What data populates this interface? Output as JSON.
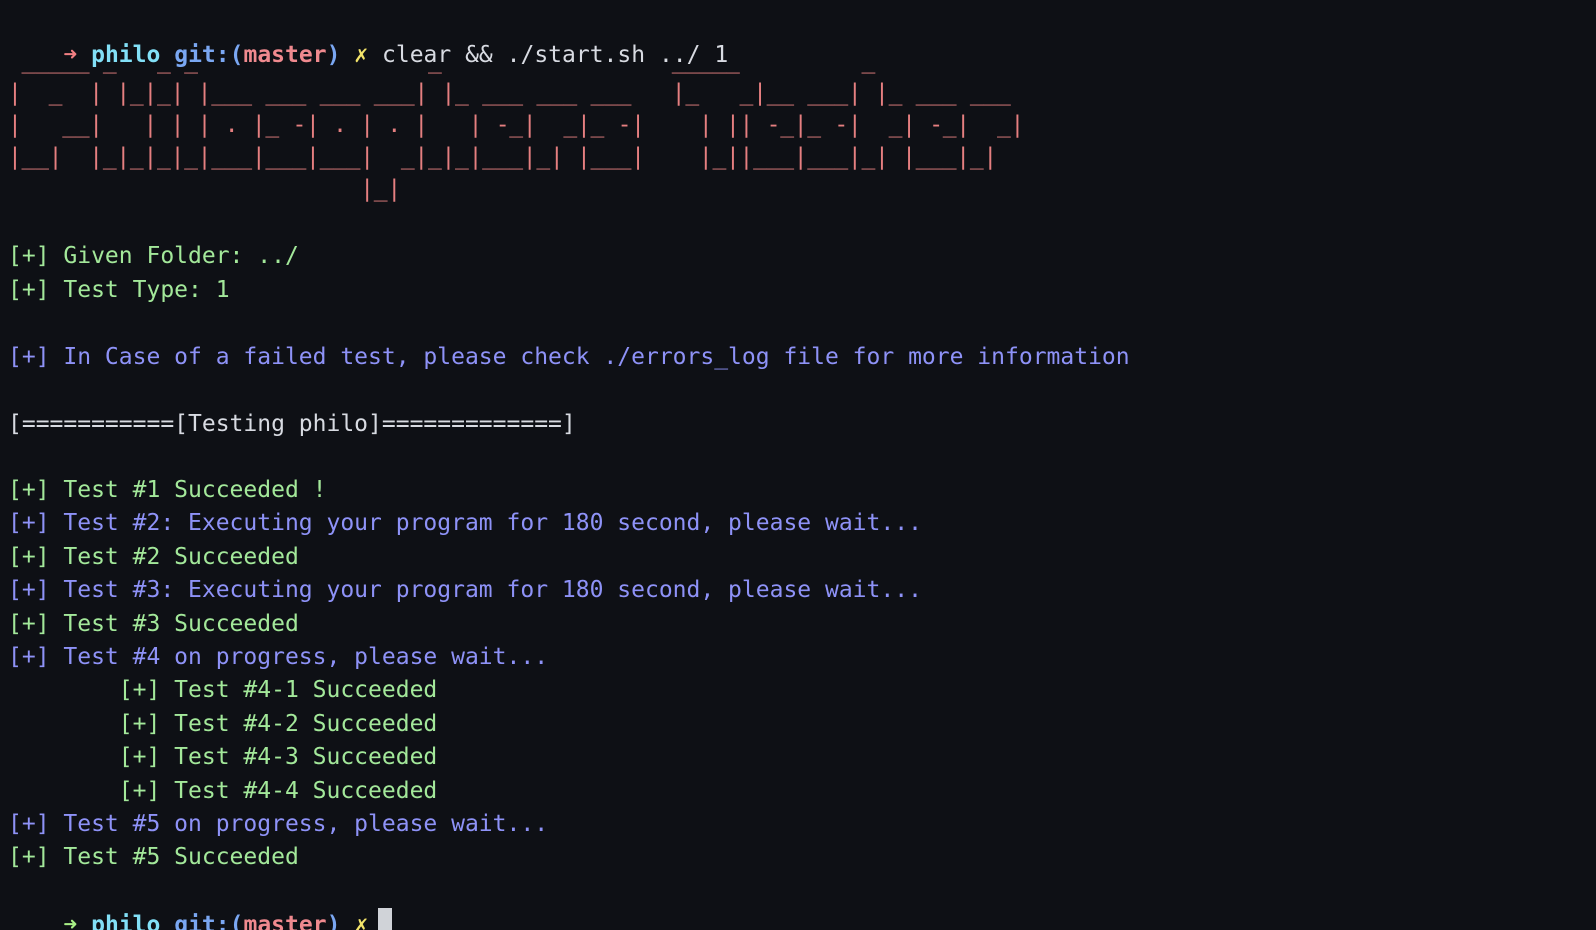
{
  "prompt1": {
    "arrow": "➜",
    "dir": "philo",
    "git_prefix": "git:(",
    "branch": "master",
    "git_suffix": ")",
    "dirty_mark": "✗",
    "command": "clear && ./start.sh ../ 1"
  },
  "banner_ascii": " _____ _   _ _                 _                 _____         _\n|  _  | |_|_| |___ ___ ___ ___| |_ ___ ___ ___   |_   _|__ ___| |_ ___ ___\n|   __|   | | | . |_ -| . | . |   | -_|  _|_ -|    | || -_|_ -|  _| -_|  _|\n|__|  |_|_|_|_|___|___|___|  _|_|_|___|_| |___|    |_||___|___|_| |___|_|\n                          |_|",
  "info": {
    "folder": "[+] Given Folder: ../",
    "type": "[+] Test Type: 1",
    "note": "[+] In Case of a failed test, please check ./errors_log file for more information",
    "header": "[===========[Testing philo]=============]"
  },
  "results": [
    {
      "text": "[+] Test #1 Succeeded !",
      "color": "green"
    },
    {
      "text": "[+] Test #2: Executing your program for 180 second, please wait...",
      "color": "blue"
    },
    {
      "text": "[+] Test #2 Succeeded",
      "color": "green"
    },
    {
      "text": "[+] Test #3: Executing your program for 180 second, please wait...",
      "color": "blue"
    },
    {
      "text": "[+] Test #3 Succeeded",
      "color": "green"
    },
    {
      "text": "[+] Test #4 on progress, please wait...",
      "color": "blue"
    },
    {
      "text": "        [+] Test #4-1 Succeeded",
      "color": "green"
    },
    {
      "text": "        [+] Test #4-2 Succeeded",
      "color": "green"
    },
    {
      "text": "        [+] Test #4-3 Succeeded",
      "color": "green"
    },
    {
      "text": "        [+] Test #4-4 Succeeded",
      "color": "green"
    },
    {
      "text": "[+] Test #5 on progress, please wait...",
      "color": "blue"
    },
    {
      "text": "[+] Test #5 Succeeded",
      "color": "green"
    }
  ],
  "prompt2": {
    "arrow": "➜",
    "dir": "philo",
    "git_prefix": "git:(",
    "branch": "master",
    "git_suffix": ")",
    "dirty_mark": "✗"
  },
  "colors": {
    "background": "#0e1015",
    "green": "#a3e89a",
    "blue": "#8e92f7",
    "ascii": "#e57f80"
  }
}
